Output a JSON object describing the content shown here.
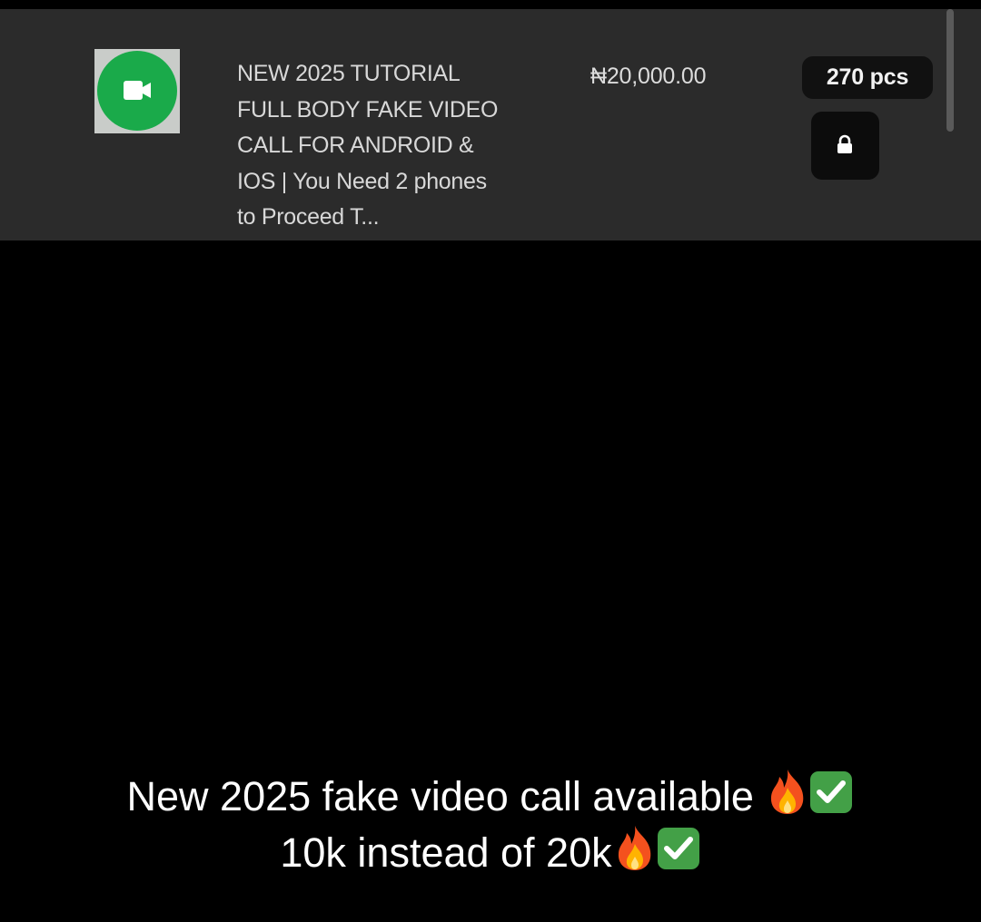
{
  "product": {
    "icon": "video-call-icon",
    "title": "NEW 2025 TUTORIAL\nFULL BODY FAKE VIDEO\nCALL FOR ANDROID &\nIOS | You Need 2 phones\nto Proceed T...",
    "price": "₦20,000.00",
    "stock": "270 pcs",
    "lock_icon": "lock-icon",
    "thumb_color": "#1aaa4a"
  },
  "caption": {
    "line1": "New 2025 fake video call available",
    "line2": "10k instead of 20k",
    "emojis": [
      "fire-emoji",
      "check-mark-emoji"
    ]
  }
}
